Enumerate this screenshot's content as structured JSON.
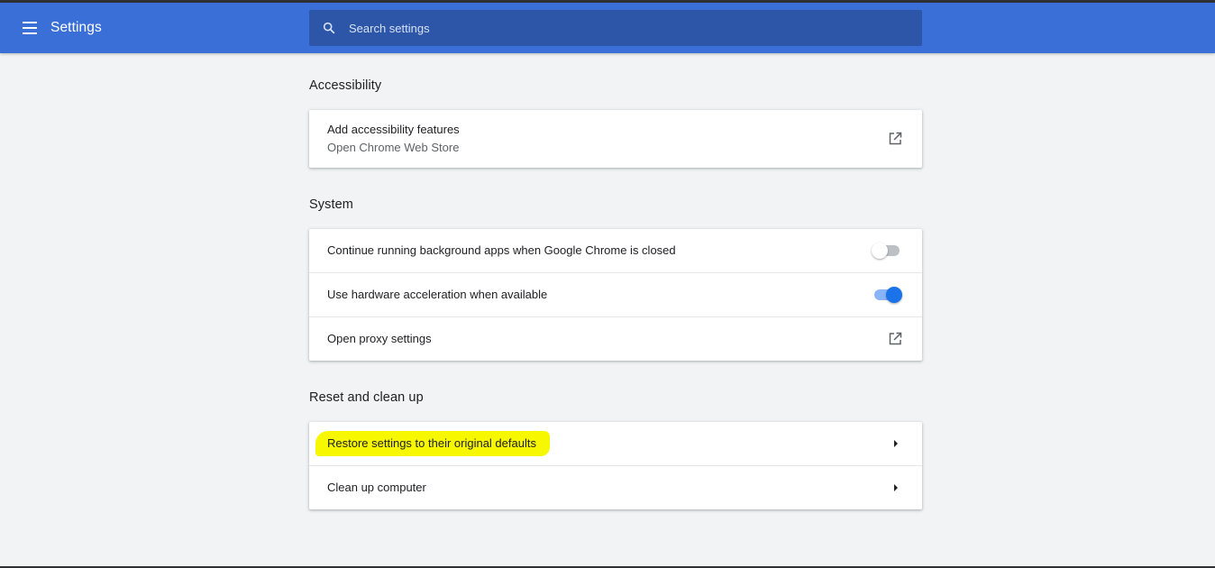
{
  "toolbar": {
    "title": "Settings",
    "menu_icon": "hamburger-menu-icon",
    "search_icon": "search-icon",
    "search_placeholder": "Search settings",
    "color": "#3a6fd8"
  },
  "sections": {
    "accessibility": {
      "title": "Accessibility",
      "items": [
        {
          "label": "Add accessibility features",
          "sublabel": "Open Chrome Web Store",
          "icon": "open-in-new-icon"
        }
      ]
    },
    "system": {
      "title": "System",
      "items": [
        {
          "label": "Continue running background apps when Google Chrome is closed",
          "control": "toggle",
          "checked": false
        },
        {
          "label": "Use hardware acceleration when available",
          "control": "toggle",
          "checked": true
        },
        {
          "label": "Open proxy settings",
          "icon": "open-in-new-icon"
        }
      ]
    },
    "reset": {
      "title": "Reset and clean up",
      "items": [
        {
          "label": "Restore settings to their original defaults",
          "icon": "arrow-right-icon",
          "highlighted": true,
          "highlight_color": "#f7f700"
        },
        {
          "label": "Clean up computer",
          "icon": "arrow-right-icon"
        }
      ]
    }
  }
}
